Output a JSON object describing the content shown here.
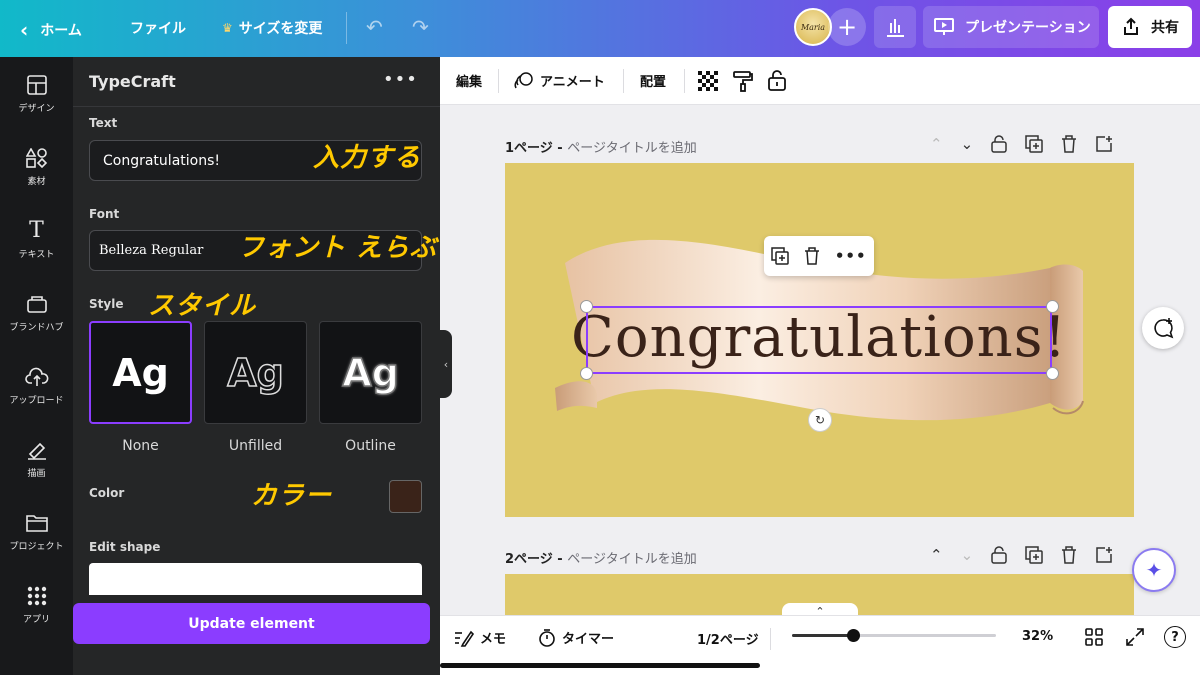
{
  "topbar": {
    "home": "ホーム",
    "file": "ファイル",
    "resize": "サイズを変更",
    "avatar_text": "Maria",
    "present": "プレゼンテーション",
    "share": "共有"
  },
  "rail": [
    {
      "label": "デザイン",
      "icon": "design-icon"
    },
    {
      "label": "素材",
      "icon": "elements-icon"
    },
    {
      "label": "テキスト",
      "icon": "text-icon"
    },
    {
      "label": "ブランドハブ",
      "icon": "brand-hub-icon"
    },
    {
      "label": "アップロード",
      "icon": "upload-icon"
    },
    {
      "label": "描画",
      "icon": "draw-icon"
    },
    {
      "label": "プロジェクト",
      "icon": "folder-icon"
    },
    {
      "label": "アプリ",
      "icon": "apps-icon"
    }
  ],
  "panel": {
    "title": "TypeCraft",
    "text_label": "Text",
    "text_value": "Congratulations!",
    "text_note": "入力する",
    "font_label": "Font",
    "font_value": "Belleza Regular",
    "font_note": "フォント えらぶ",
    "style_label": "Style",
    "style_note": "スタイル",
    "styles": [
      {
        "glyph": "Ag",
        "label": "None",
        "selected": true
      },
      {
        "glyph": "Ag",
        "label": "Unfilled",
        "selected": false
      },
      {
        "glyph": "Ag",
        "label": "Outline",
        "selected": false
      }
    ],
    "color_label": "Color",
    "color_note": "カラー",
    "color_value": "#3a2319",
    "edit_shape_label": "Edit shape",
    "update_button": "Update element"
  },
  "editor_toolbar": {
    "edit": "編集",
    "animate": "アニメート",
    "position": "配置"
  },
  "pages": [
    {
      "number": "1ページ - ",
      "title_placeholder": "ページタイトルを追加"
    },
    {
      "number": "2ページ - ",
      "title_placeholder": "ページタイトルを追加"
    }
  ],
  "canvas": {
    "headline": "Congratulations!",
    "background_color": "#dfc96a"
  },
  "bottombar": {
    "notes": "メモ",
    "timer": "タイマー",
    "page_indicator": "1/2ページ",
    "zoom": "32%",
    "zoom_fraction": 0.3
  }
}
